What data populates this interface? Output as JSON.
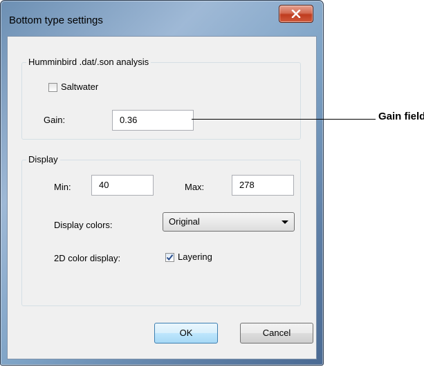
{
  "window": {
    "title": "Bottom type settings"
  },
  "analysis_group": {
    "legend": "Humminbird .dat/.son analysis",
    "saltwater": {
      "label": "Saltwater",
      "checked": false
    },
    "gain": {
      "label": "Gain:",
      "value": "0.36"
    }
  },
  "display_group": {
    "legend": "Display",
    "min": {
      "label": "Min:",
      "value": "40"
    },
    "max": {
      "label": "Max:",
      "value": "278"
    },
    "colors": {
      "label": "Display colors:",
      "selected": "Original"
    },
    "color2d": {
      "label": "2D color display:",
      "checkbox_label": "Layering",
      "checked": true
    }
  },
  "buttons": {
    "ok": "OK",
    "cancel": "Cancel"
  },
  "callout": {
    "text": "Gain field"
  },
  "icons": {
    "close": "close-icon",
    "dropdown": "chevron-down-icon",
    "check": "check-icon"
  }
}
